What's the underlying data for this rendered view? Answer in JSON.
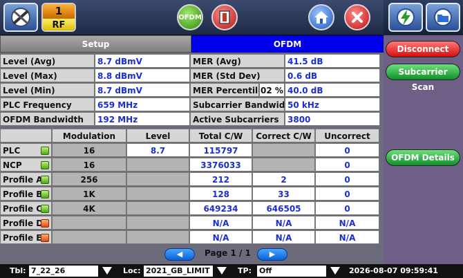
{
  "toolbar": {
    "rf_number": "1",
    "rf_label": "RF",
    "ofdm_label": "OFDM"
  },
  "tabs": {
    "setup": "Setup",
    "ofdm": "OFDM"
  },
  "summary": {
    "left": [
      {
        "label": "Level (Avg)",
        "value": "8.7 dBmV"
      },
      {
        "label": "Level (Max)",
        "value": "8.8 dBmV"
      },
      {
        "label": "Level (Min)",
        "value": "8.7 dBmV"
      },
      {
        "label": "PLC Frequency",
        "value": "659 MHz"
      },
      {
        "label": "OFDM Bandwidth",
        "value": "192 MHz"
      }
    ],
    "right": [
      {
        "label": "MER (Avg)",
        "value": "41.5 dB"
      },
      {
        "label": "MER (Std Dev)",
        "value": "0.6 dB"
      },
      {
        "label": "MER Percentile",
        "extra": "02 %",
        "value": "40.0 dB"
      },
      {
        "label": "Subcarrier Bandwidth",
        "value": "50 kHz"
      },
      {
        "label": "Active Subcarriers",
        "value": "3800"
      }
    ]
  },
  "table": {
    "headers": [
      "",
      "Modulation (QAM)",
      "Level (dBmV)",
      "Total C/W",
      "Correct C/W",
      "Uncorrect C/W"
    ],
    "rows": [
      {
        "name": "PLC",
        "lock": "green",
        "modulation": "16",
        "level": "8.7",
        "total": "115797",
        "correct": "",
        "uncorrect": "0"
      },
      {
        "name": "NCP",
        "lock": "green",
        "modulation": "16",
        "level": "",
        "total": "3376033",
        "correct": "",
        "uncorrect": "0"
      },
      {
        "name": "Profile A",
        "lock": "green",
        "modulation": "256",
        "level": "",
        "total": "212",
        "correct": "2",
        "uncorrect": "0"
      },
      {
        "name": "Profile B",
        "lock": "green",
        "modulation": "1K",
        "level": "",
        "total": "128",
        "correct": "33",
        "uncorrect": "0"
      },
      {
        "name": "Profile C",
        "lock": "green",
        "modulation": "4K",
        "level": "",
        "total": "649234",
        "correct": "646505",
        "uncorrect": "0"
      },
      {
        "name": "Profile D",
        "lock": "red",
        "modulation": "",
        "level": "",
        "total": "N/A",
        "correct": "N/A",
        "uncorrect": "N/A"
      },
      {
        "name": "Profile E",
        "lock": "red",
        "modulation": "",
        "level": "",
        "total": "N/A",
        "correct": "N/A",
        "uncorrect": "N/A"
      }
    ]
  },
  "pager": {
    "text": "Page 1 / 1",
    "prev": "◀",
    "next": "▶"
  },
  "side": {
    "disconnect": "Disconnect",
    "subcarrier_scan": "Subcarrier Scan",
    "ofdm_details": "OFDM Details"
  },
  "status": {
    "tbl_label": "Tbl:",
    "tbl_value": "7_22_26",
    "loc_label": "Loc:",
    "loc_value": "2021_GB_LIMIT",
    "tp_label": "TP:",
    "tp_value": "Off",
    "datetime": "2026-08-07  09:59:41"
  },
  "colors": {
    "tab_active": "#0000ee",
    "value_text": "#1a2fd0",
    "lock_ok": "#4da81a",
    "lock_bad": "#e04a10"
  }
}
